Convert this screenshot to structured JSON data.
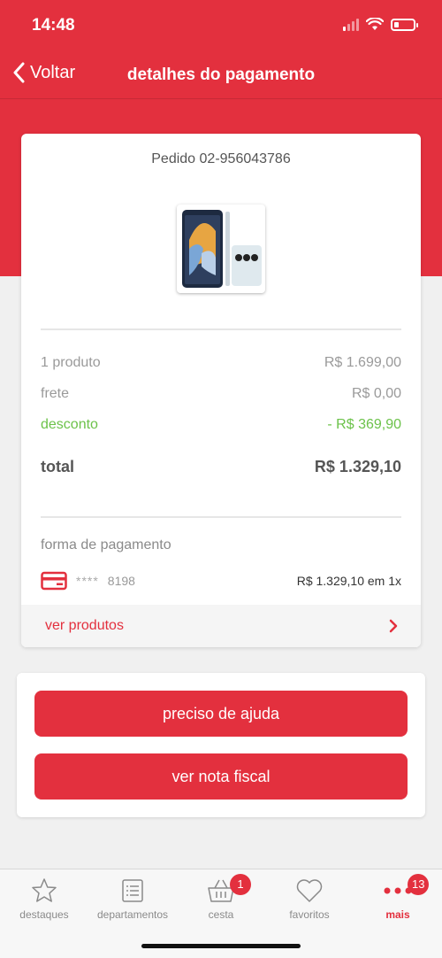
{
  "status": {
    "time": "14:48"
  },
  "nav": {
    "back_label": "Voltar",
    "title": "detalhes do pagamento"
  },
  "order": {
    "number_label": "Pedido 02-956043786",
    "summary": {
      "products_label": "1 produto",
      "products_value": "R$ 1.699,00",
      "shipping_label": "frete",
      "shipping_value": "R$ 0,00",
      "discount_label": "desconto",
      "discount_value": "- R$ 369,90",
      "total_label": "total",
      "total_value": "R$ 1.329,10"
    },
    "payment": {
      "label": "forma de pagamento",
      "masked": "****",
      "card_last4": "8198",
      "amount": "R$ 1.329,10 em 1x"
    },
    "see_products_label": "ver produtos"
  },
  "actions": {
    "help_label": "preciso de ajuda",
    "invoice_label": "ver nota fiscal"
  },
  "tabs": [
    {
      "label": "destaques",
      "icon": "star-icon"
    },
    {
      "label": "departamentos",
      "icon": "list-icon"
    },
    {
      "label": "cesta",
      "icon": "basket-icon",
      "badge": "1"
    },
    {
      "label": "favoritos",
      "icon": "heart-icon"
    },
    {
      "label": "mais",
      "icon": "more-icon",
      "badge": "13",
      "active": true
    }
  ],
  "colors": {
    "brand_red": "#e3303e",
    "discount_green": "#6cc24a"
  }
}
